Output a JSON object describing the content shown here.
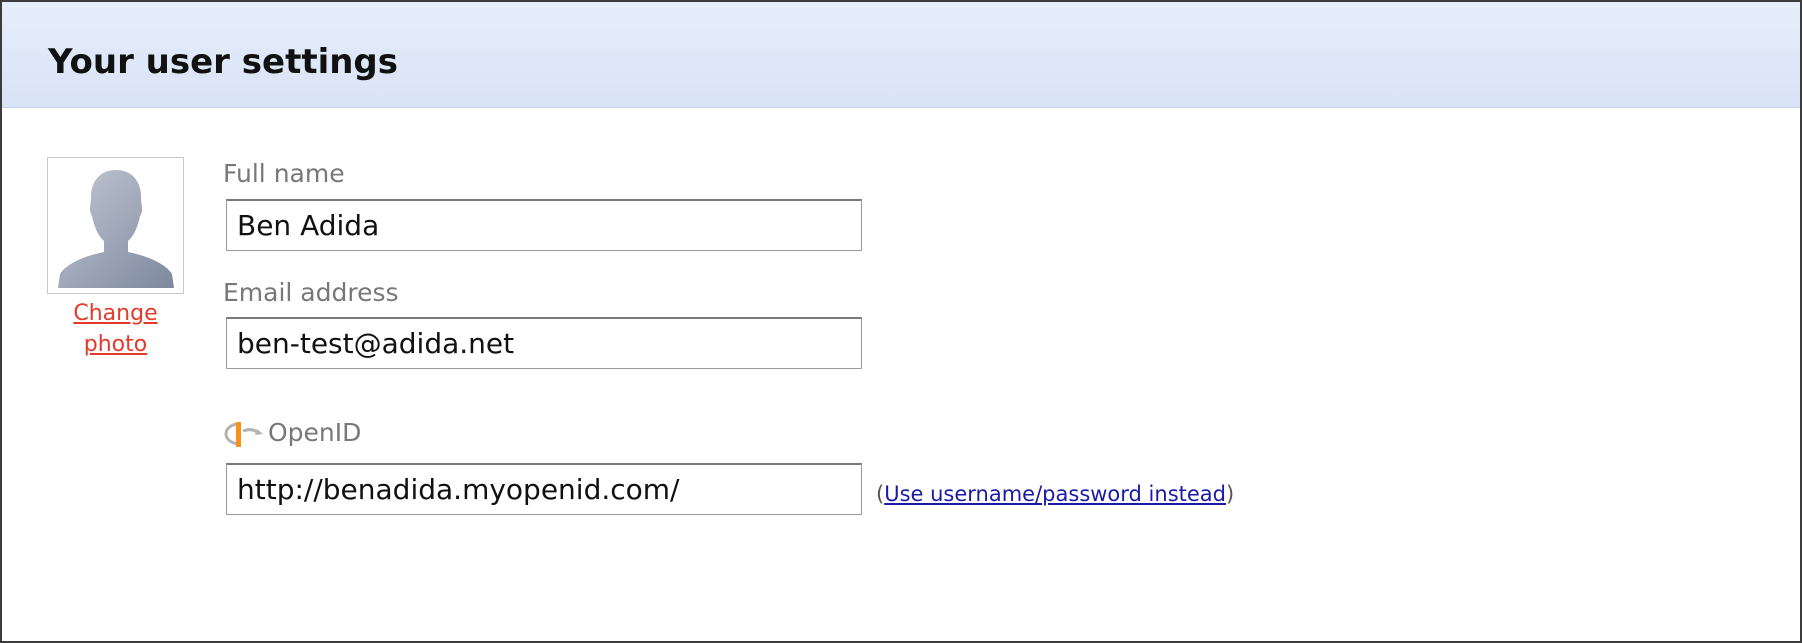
{
  "page": {
    "title": "Your user settings"
  },
  "photo": {
    "change_label_line1": "Change",
    "change_label_line2": "photo"
  },
  "form": {
    "full_name": {
      "label": "Full name",
      "value": "Ben Adida"
    },
    "email": {
      "label": "Email address",
      "value": "ben-test@adida.net"
    },
    "openid": {
      "label": "OpenID",
      "value": "http://benadida.myopenid.com/",
      "alt_prefix": "(",
      "alt_link": "Use username/password instead",
      "alt_suffix": ")"
    }
  },
  "colors": {
    "header_bg": "#dde6f7",
    "link_red": "#e43a2a",
    "link_blue": "#1a1aa8",
    "label_gray": "#787878",
    "openid_orange": "#f7921e"
  },
  "icons": {
    "avatar": "avatar-silhouette-icon",
    "openid": "openid-logo-icon"
  }
}
